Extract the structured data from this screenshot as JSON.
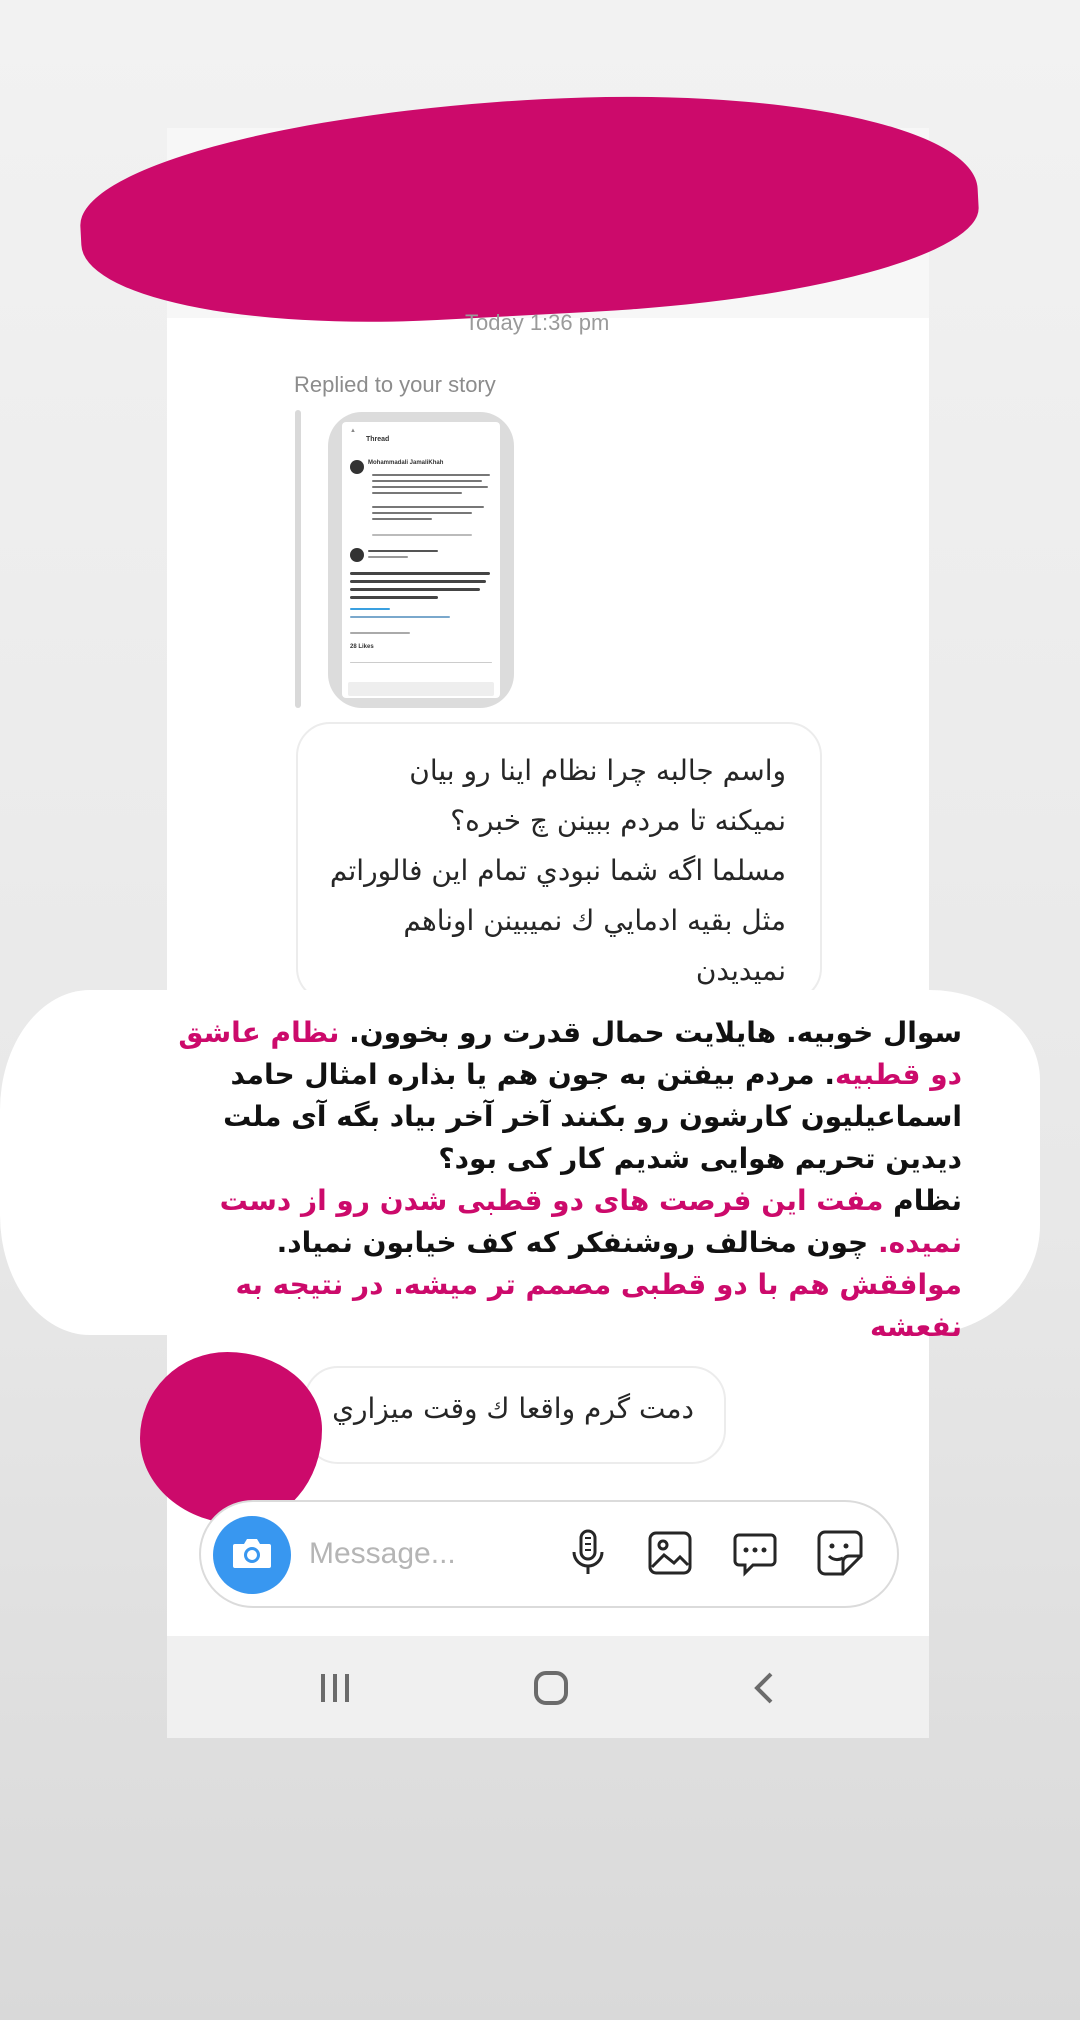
{
  "conversation": {
    "timestamp": "Today 1:36 pm",
    "replied_label": "Replied to your story",
    "story_preview": {
      "header": "Thread",
      "author": "Mohammadali JamaliKhah",
      "footer": "28 Likes"
    },
    "message_1": "واسم جالبه چرا نظام اینا رو بیان\nنمیکنه تا مردم ببینن چ خبره؟\nمسلما اگه شما نبودي تمام این فالوراتم\nمثل بقیه ادمایي ك نمیبینن اوناهم\nنمیدیدن",
    "message_2": "دمت گرم واقعا ك وقت میزاري"
  },
  "overlay": {
    "s1": "سوال خوبیه. هایلایت حمال قدرت رو بخوون.",
    "s2": "نظام عاشق دو قطبیه",
    "s3": ". مردم بیفتن به جون هم یا بذاره امثال حامد اسماعیلیون کارشون رو بکنند آخر آخر بیاد بگه آی ملت دیدین تحریم هوایی شدیم کار کی بود؟",
    "s4": "نظام",
    "s5": "مفت این فرصت های دو قطبی شدن رو از دست نمیده.",
    "s6": "چون مخالف روشنفکر که کف خیابون نمیاد.",
    "s7": "موافقش هم با دو قطبی مصمم تر میشه. در نتیجه به نفعشه"
  },
  "composer": {
    "placeholder": "Message..."
  },
  "icons": {
    "camera": "camera-icon",
    "mic": "microphone-icon",
    "gallery": "image-icon",
    "chat": "chat-bubble-icon",
    "sticker": "sticker-icon"
  },
  "colors": {
    "accent_pink": "#cc0a6b",
    "camera_blue": "#3897f0"
  }
}
